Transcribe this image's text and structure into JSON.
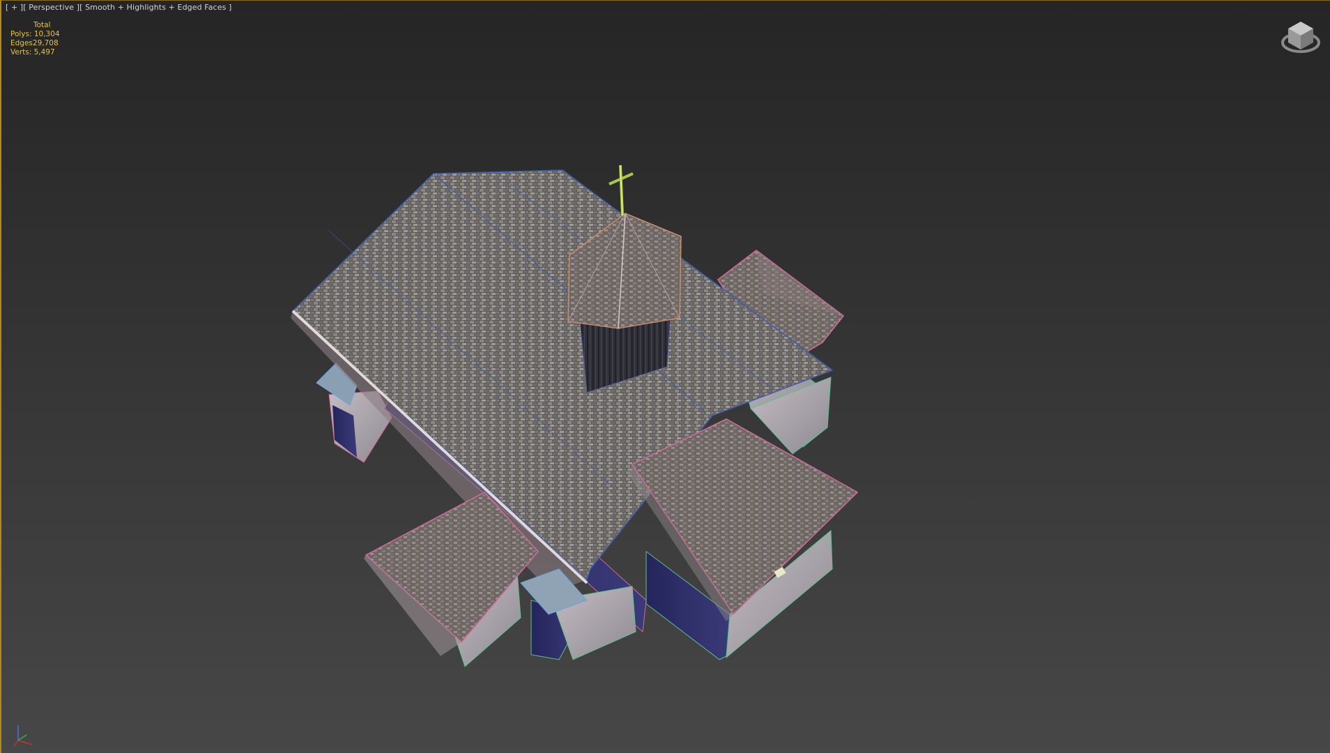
{
  "viewport": {
    "menu": {
      "plus": "[ + ]",
      "view": "[ Perspective ]",
      "shading": "[ Smooth + Highlights + Edged Faces ]"
    },
    "stats": {
      "total_label": "Total",
      "polys": "Polys: 10,304",
      "edges": "Edges29,708",
      "verts": "Verts: 5,497"
    },
    "icons": {
      "viewcube": "viewcube-icon",
      "axis": "axis-tripod-icon"
    },
    "colors": {
      "viewport_border": "#b28a17",
      "stats_text": "#e6c33a",
      "label_text": "#d4d4d4"
    }
  }
}
